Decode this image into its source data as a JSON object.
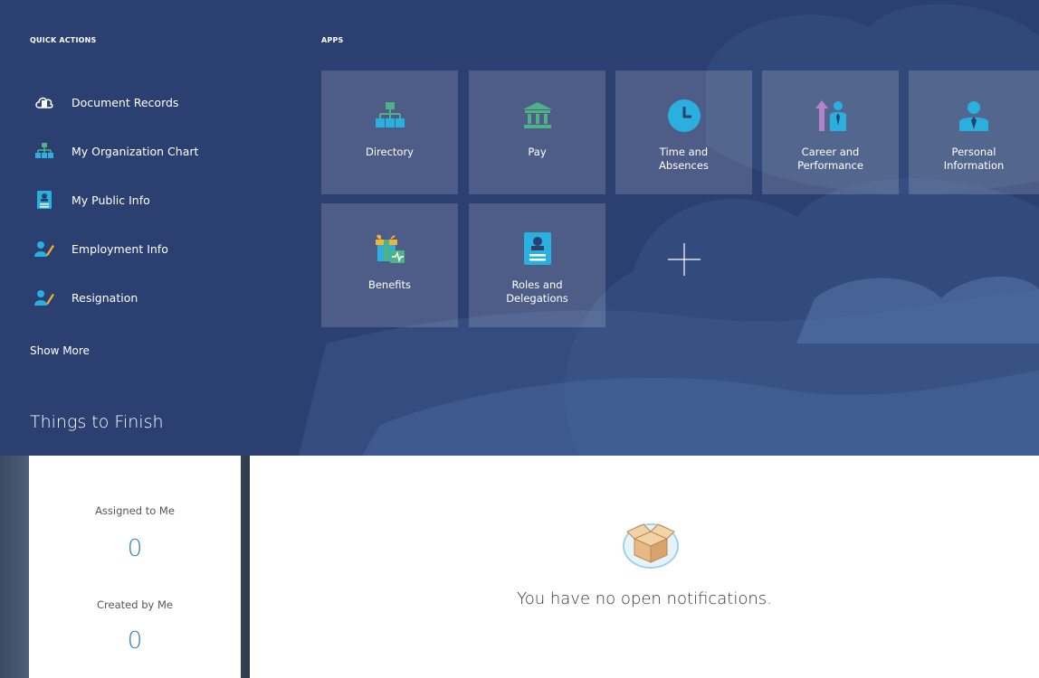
{
  "colors": {
    "hero_bg": "#2b3f71",
    "accent_blue": "#2f7ebe",
    "icon_green": "#4fb286",
    "icon_cyan": "#2ab0de"
  },
  "quick_actions": {
    "heading": "QUICK ACTIONS",
    "items": [
      {
        "label": "Document Records",
        "icon": "cloud-document-icon"
      },
      {
        "label": "My Organization Chart",
        "icon": "org-chart-icon"
      },
      {
        "label": "My Public Info",
        "icon": "person-card-icon"
      },
      {
        "label": "Employment Info",
        "icon": "person-edit-icon"
      },
      {
        "label": "Resignation",
        "icon": "person-edit-icon"
      }
    ],
    "show_more": "Show More"
  },
  "apps": {
    "heading": "APPS",
    "tiles": [
      {
        "label": "Directory",
        "icon": "org-chart-icon"
      },
      {
        "label": "Pay",
        "icon": "bank-icon"
      },
      {
        "label": "Time and\nAbsences",
        "icon": "clock-icon"
      },
      {
        "label": "Career and\nPerformance",
        "icon": "career-growth-icon"
      },
      {
        "label": "Personal\nInformation",
        "icon": "person-icon"
      },
      {
        "label": "Benefits",
        "icon": "gift-icon"
      },
      {
        "label": "Roles and\nDelegations",
        "icon": "id-badge-icon"
      }
    ],
    "add_icon": "plus-icon"
  },
  "things_to_finish": {
    "title": "Things to Finish",
    "assigned_label": "Assigned to Me",
    "assigned_count": "0",
    "created_label": "Created by Me",
    "created_count": "0"
  },
  "notifications": {
    "empty_text": "You have no open notifications.",
    "icon": "open-box-icon"
  }
}
